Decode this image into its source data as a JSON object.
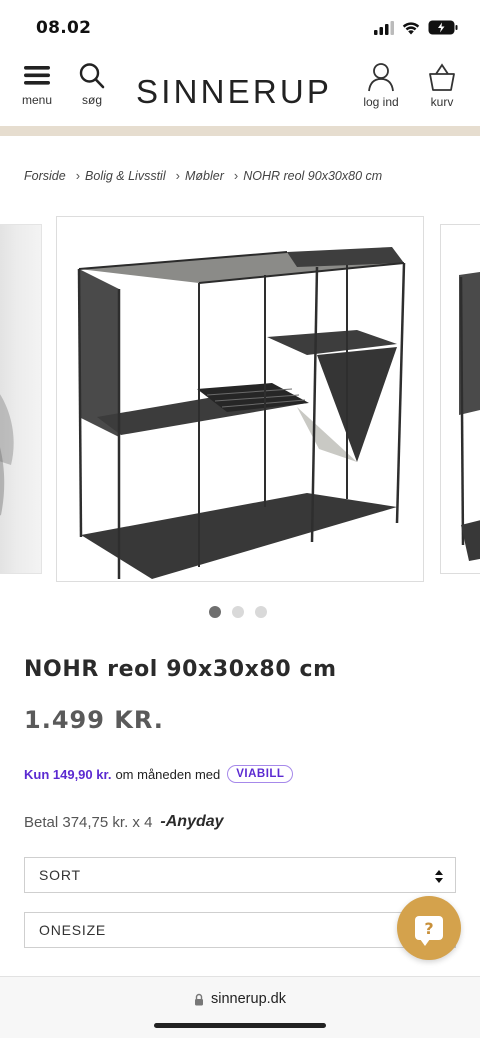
{
  "status": {
    "time": "08.02"
  },
  "header": {
    "menu_label": "menu",
    "search_label": "søg",
    "brand": "SINNERUP",
    "login_label": "log ind",
    "cart_label": "kurv"
  },
  "breadcrumb": {
    "items": [
      "Forside",
      "Bolig & Livsstil",
      "Møbler",
      "NOHR reol 90x30x80 cm"
    ]
  },
  "gallery": {
    "image_count": 3,
    "active_index": 0
  },
  "product": {
    "title": "NOHR reol 90x30x80 cm",
    "price": "1.499 KR.",
    "viabill_amount": "Kun 149,90 kr.",
    "viabill_text": "om måneden med",
    "viabill_logo": "VIABILL",
    "anyday_text": "Betal 374,75 kr. x 4",
    "anyday_logo": "Anyday",
    "color_select": "SORT",
    "size_select": "ONESIZE"
  },
  "help": {
    "symbol": "?"
  },
  "browser": {
    "url": "sinnerup.dk"
  },
  "colors": {
    "beige_bar": "#e6ddcf",
    "viabill_purple": "#5b2ad1",
    "help_button": "#d4a24c",
    "price_grey": "#5a5a5a"
  }
}
